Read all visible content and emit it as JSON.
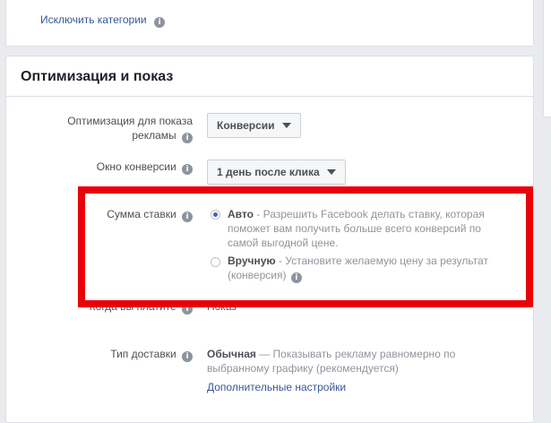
{
  "top_card": {
    "exclude_categories_label": "Исключить категории"
  },
  "section": {
    "title": "Оптимизация и показ",
    "optimization_label_line1": "Оптимизация для показа",
    "optimization_label_line2": "рекламы",
    "optimization_value": "Конверсии",
    "conversion_window_label": "Окно конверсии",
    "conversion_window_value": "1 день после клика",
    "bid_amount_label": "Сумма ставки",
    "bid_options": [
      {
        "title": "Авто",
        "desc_line1": " - Разрешить Facebook делать ставку, которая",
        "desc_line2": "поможет вам получить больше всего конверсий по",
        "desc_line3": "самой выгодной цене.",
        "selected": true
      },
      {
        "title": "Вручную",
        "desc_line1": " - Установите желаемую цену за результат",
        "desc_line2": "(конверсия)",
        "selected": false
      }
    ],
    "when_you_pay_label": "Когда вы платите",
    "when_you_pay_value": "Показ",
    "delivery_type_label": "Тип доставки",
    "delivery_title": "Обычная",
    "delivery_desc_line1": " — Показывать рекламу равномерно по",
    "delivery_desc_line2": "выбранному графику (рекомендуется)",
    "advanced_settings_link": "Дополнительные настройки"
  },
  "colors": {
    "highlight_border": "#e8000b",
    "link": "#365899",
    "radio_selected": "#4267b2"
  }
}
